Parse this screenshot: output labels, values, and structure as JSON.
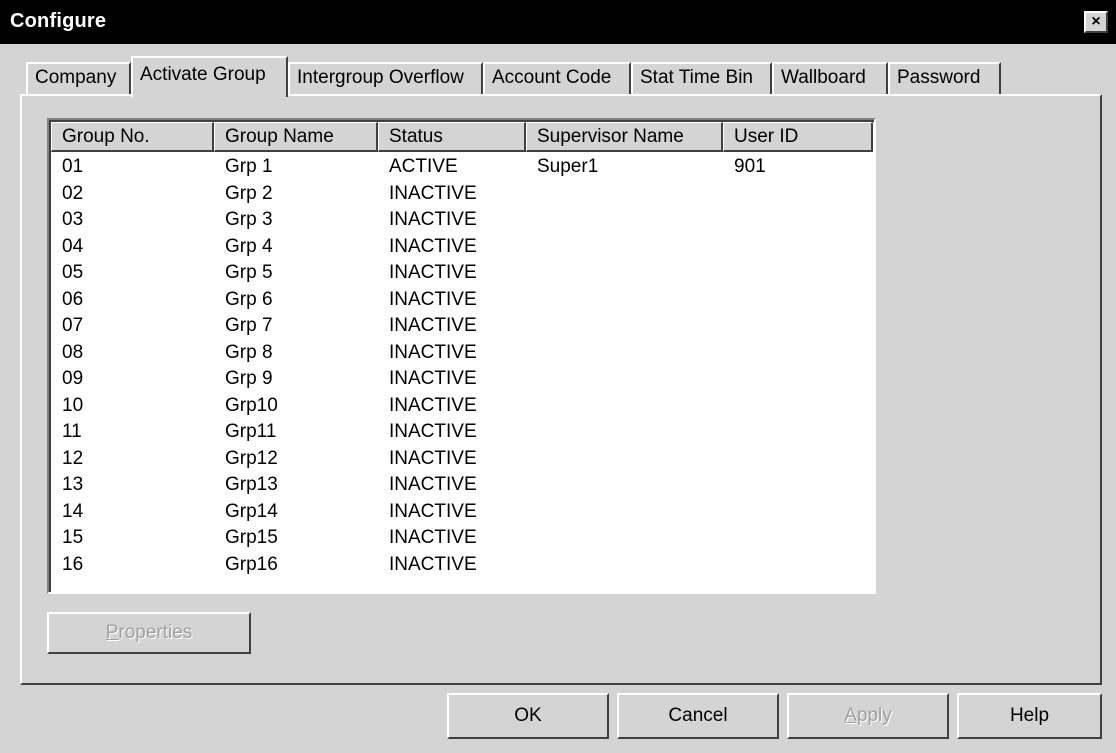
{
  "window": {
    "title": "Configure",
    "close_glyph": "×"
  },
  "tabs": [
    {
      "label": "Company",
      "active": false
    },
    {
      "label": "Activate Group",
      "active": true
    },
    {
      "label": "Intergroup Overflow",
      "active": false
    },
    {
      "label": "Account Code",
      "active": false
    },
    {
      "label": "Stat Time Bin",
      "active": false
    },
    {
      "label": "Wallboard",
      "active": false
    },
    {
      "label": "Password",
      "active": false
    }
  ],
  "table": {
    "columns": [
      "Group No.",
      "Group Name",
      "Status",
      "Supervisor Name",
      "User ID"
    ],
    "rows": [
      [
        "01",
        "Grp 1",
        "ACTIVE",
        "Super1",
        "901"
      ],
      [
        "02",
        "Grp 2",
        "INACTIVE",
        "",
        ""
      ],
      [
        "03",
        "Grp 3",
        "INACTIVE",
        "",
        ""
      ],
      [
        "04",
        "Grp 4",
        "INACTIVE",
        "",
        ""
      ],
      [
        "05",
        "Grp 5",
        "INACTIVE",
        "",
        ""
      ],
      [
        "06",
        "Grp 6",
        "INACTIVE",
        "",
        ""
      ],
      [
        "07",
        "Grp 7",
        "INACTIVE",
        "",
        ""
      ],
      [
        "08",
        "Grp 8",
        "INACTIVE",
        "",
        ""
      ],
      [
        "09",
        "Grp 9",
        "INACTIVE",
        "",
        ""
      ],
      [
        "10",
        "Grp10",
        "INACTIVE",
        "",
        ""
      ],
      [
        "11",
        "Grp11",
        "INACTIVE",
        "",
        ""
      ],
      [
        "12",
        "Grp12",
        "INACTIVE",
        "",
        ""
      ],
      [
        "13",
        "Grp13",
        "INACTIVE",
        "",
        ""
      ],
      [
        "14",
        "Grp14",
        "INACTIVE",
        "",
        ""
      ],
      [
        "15",
        "Grp15",
        "INACTIVE",
        "",
        ""
      ],
      [
        "16",
        "Grp16",
        "INACTIVE",
        "",
        ""
      ]
    ]
  },
  "buttons": {
    "properties": {
      "first": "P",
      "rest": "roperties",
      "enabled": false
    },
    "ok": {
      "label": "OK"
    },
    "cancel": {
      "label": "Cancel"
    },
    "apply": {
      "first": "A",
      "rest": "pply",
      "enabled": false
    },
    "help": {
      "label": "Help"
    }
  }
}
